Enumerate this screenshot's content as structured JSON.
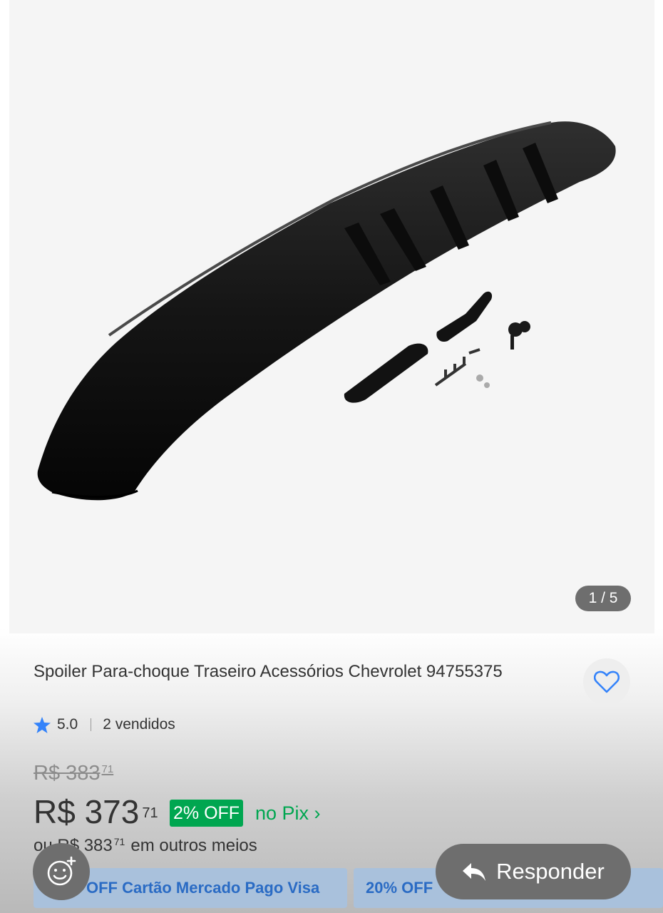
{
  "gallery": {
    "counter": "1 / 5"
  },
  "product": {
    "title": "Spoiler Para-choque Traseiro Acessórios Chevrolet 94755375",
    "rating": "5.0",
    "sold": "2 vendidos"
  },
  "pricing": {
    "old_integer": "R$ 383",
    "old_cents": "71",
    "current_integer": "R$ 373",
    "current_cents": "71",
    "discount": "2% OFF",
    "pix_label": "no Pix ›",
    "alt_prefix": "ou R$ 383",
    "alt_cents": "71",
    "alt_suffix": "em outros meios"
  },
  "promos": [
    {
      "label": "OFF Cartão Mercado Pago Visa"
    },
    {
      "label": "20% OFF"
    }
  ],
  "actions": {
    "reply_label": "Responder"
  },
  "icons": {
    "favorite": "heart-icon",
    "rating": "star-icon",
    "emoji": "add-emoji-icon",
    "reply": "reply-arrow-icon"
  },
  "colors": {
    "accent_blue": "#3483fa",
    "discount_green": "#00a650",
    "overlay_gray": "#6e6e6e"
  }
}
